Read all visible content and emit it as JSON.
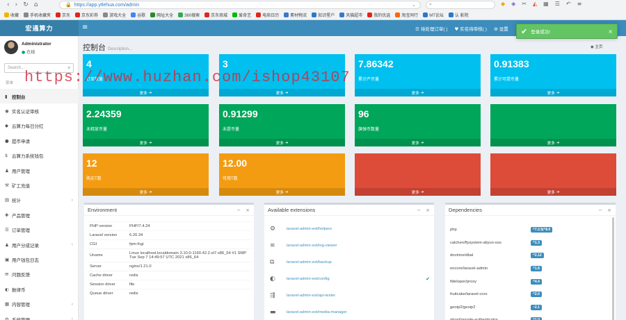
{
  "browser": {
    "nav_icons": [
      "back-icon",
      "forward-icon",
      "refresh-icon",
      "home-icon"
    ],
    "url": "https://app.ytlehua.com/admin",
    "search_icon": "search-icon",
    "bookmarks": [
      {
        "label": "收藏",
        "color": "#f0b400"
      },
      {
        "label": "手机收藏夹",
        "color": "#888"
      },
      {
        "label": "京东",
        "color": "#e1251b"
      },
      {
        "label": "京东彩券",
        "color": "#e1251b"
      },
      {
        "label": "游戏大全",
        "color": "#888"
      },
      {
        "label": "谷歌",
        "color": "#4285f4"
      },
      {
        "label": "网址大全",
        "color": "#2a8a2a"
      },
      {
        "label": "360搜索",
        "color": "#33a853"
      },
      {
        "label": "京东商城",
        "color": "#e1251b"
      },
      {
        "label": "爱奇艺",
        "color": "#00be06"
      },
      {
        "label": "电商日历",
        "color": "#e1251b"
      },
      {
        "label": "素材物流",
        "color": "#3a78c8"
      },
      {
        "label": "知识星户",
        "color": "#2a7ac7"
      },
      {
        "label": "天猫超市",
        "color": "#3a78c8"
      },
      {
        "label": "我的优选",
        "color": "#e1251b"
      },
      {
        "label": "淘宝同行",
        "color": "#f60"
      },
      {
        "label": "MT论坛",
        "color": "#2a7ac7"
      },
      {
        "label": "认 影院",
        "color": "#2a7ac7"
      }
    ]
  },
  "header": {
    "logo": "宏通算力",
    "menu_icon": "bars-icon",
    "nav": [
      {
        "icon": "☰",
        "label": "待处理订单( )"
      },
      {
        "icon": "♥",
        "label": "实名待审核( )"
      },
      {
        "icon": "⚙",
        "label": "设置"
      }
    ]
  },
  "toast": {
    "message": "登录成功!",
    "color": "#62c462"
  },
  "sidebar": {
    "user_name": "Administrator",
    "status": "在线",
    "search_placeholder": "Search...",
    "menu_header": "菜单",
    "items": [
      {
        "icon": "▮",
        "label": "控制台",
        "active": true,
        "arrow": ""
      },
      {
        "icon": "◉",
        "label": "实名认证审核",
        "arrow": ""
      },
      {
        "icon": "◆",
        "label": "云算力每日分红",
        "arrow": ""
      },
      {
        "icon": "●",
        "label": "提币申请",
        "arrow": ""
      },
      {
        "icon": "$",
        "label": "云算力系统钱包",
        "arrow": ""
      },
      {
        "icon": "♟",
        "label": "用户管理",
        "arrow": ""
      },
      {
        "icon": "⚒",
        "label": "矿工充值",
        "arrow": ""
      },
      {
        "icon": "▤",
        "label": "统计",
        "arrow": "‹"
      },
      {
        "icon": "✚",
        "label": "产品管理",
        "arrow": ""
      },
      {
        "icon": "☰",
        "label": "订单管理",
        "arrow": ""
      },
      {
        "icon": "♟",
        "label": "用户分成记录",
        "arrow": "‹"
      },
      {
        "icon": "▣",
        "label": "用户钱包日志",
        "arrow": ""
      },
      {
        "icon": "✉",
        "label": "问题反馈",
        "arrow": ""
      },
      {
        "icon": "◐",
        "label": "数律币",
        "arrow": ""
      },
      {
        "icon": "▦",
        "label": "内容管理",
        "arrow": "‹"
      },
      {
        "icon": "⚙",
        "label": "系统管理",
        "arrow": "‹"
      }
    ]
  },
  "page": {
    "title": "控制台",
    "subtitle": "Description...",
    "breadcrumb": "主页",
    "breadcrumb_icon": "dashboard-icon"
  },
  "tiles": [
    {
      "value": "4",
      "label": "订单数量",
      "color": "aqua",
      "more": "更多",
      "ghost": "🛒"
    },
    {
      "value": "3",
      "label": "",
      "color": "aqua",
      "more": "更多",
      "ghost": "🛒"
    },
    {
      "value": "7.86342",
      "label": "累计产币量",
      "color": "aqua",
      "more": "更多",
      "ghost": ""
    },
    {
      "value": "0.91383",
      "label": "累计可提币量",
      "color": "aqua",
      "more": "更多",
      "ghost": ""
    },
    {
      "value": "2.24359",
      "label": "未释放币量",
      "color": "green",
      "more": "更多",
      "ghost": ""
    },
    {
      "value": "0.91299",
      "label": "未提币量",
      "color": "green",
      "more": "更多",
      "ghost": ""
    },
    {
      "value": "96",
      "label": "旗弹币数量",
      "color": "green",
      "more": "更多",
      "ghost": ""
    },
    {
      "value": "",
      "label": "",
      "color": "green",
      "more": "更多",
      "ghost": ""
    },
    {
      "value": "12",
      "label": "购买T数",
      "color": "yellow",
      "more": "更多",
      "ghost": ""
    },
    {
      "value": "12.00",
      "label": "可用T数",
      "color": "yellow",
      "more": "更多",
      "ghost": ""
    },
    {
      "value": "",
      "label": "",
      "color": "red",
      "more": "更多",
      "ghost": ""
    },
    {
      "value": "",
      "label": "",
      "color": "red",
      "more": "更多",
      "ghost": ""
    }
  ],
  "environment": {
    "title": "Environment",
    "rows": [
      {
        "k": "PHP version",
        "v": "PHP/7.4.24"
      },
      {
        "k": "Laravel version",
        "v": "6.20.34"
      },
      {
        "k": "CGI",
        "v": "fpm-fcgi"
      },
      {
        "k": "Uname",
        "v": "Linux localhost.localdomain 3.10.0-1160.42.2.el7.x86_64 #1 SMP Tue Sep 7 14:49:57 UTC 2021 x86_64"
      },
      {
        "k": "Server",
        "v": "nginx/1.21.0"
      },
      {
        "k": "Cache driver",
        "v": "redis"
      },
      {
        "k": "Session driver",
        "v": "file"
      },
      {
        "k": "Queue driver",
        "v": "redis"
      }
    ]
  },
  "extensions": {
    "title": "Available extensions",
    "items": [
      {
        "icon": "⚙",
        "name": "laravel-admin-ext/helpers",
        "installed": false
      },
      {
        "icon": "≋",
        "name": "laravel-admin-ext/log-viewer",
        "installed": false
      },
      {
        "icon": "⧉",
        "name": "laravel-admin-ext/backup",
        "installed": false
      },
      {
        "icon": "◐",
        "name": "laravel-admin-ext/config",
        "installed": true
      },
      {
        "icon": "⇶",
        "name": "laravel-admin-ext/api-tester",
        "installed": false
      },
      {
        "icon": "▬",
        "name": "laravel-admin-ext/media-manager",
        "installed": false
      }
    ]
  },
  "dependencies": {
    "title": "Dependencies",
    "items": [
      {
        "name": "php",
        "version": "^7.2.5|^8.0"
      },
      {
        "name": "calchen/flysystem-aliyun-oss",
        "version": "^1.3"
      },
      {
        "name": "doctrine/dbal",
        "version": "^2.12"
      },
      {
        "name": "encore/laravel-admin",
        "version": "^1.8"
      },
      {
        "name": "fideloper/proxy",
        "version": "^4.4"
      },
      {
        "name": "fruitcake/laravel-cors",
        "version": "^2.0"
      },
      {
        "name": "geoip2/geoip2",
        "version": "~2.1"
      },
      {
        "name": "ghost/google-authenticator",
        "version": "^1.0"
      }
    ]
  },
  "watermark": "https://www.huzhan.com/ishop43107"
}
